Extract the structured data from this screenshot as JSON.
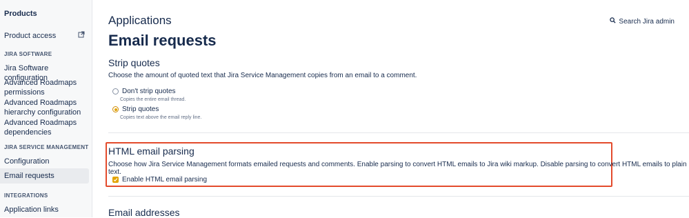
{
  "sidebar": {
    "title": "Products",
    "product_access": "Product access",
    "sections": [
      {
        "heading": "JIRA SOFTWARE"
      },
      {
        "heading": "JIRA SERVICE MANAGEMENT"
      },
      {
        "heading": "INTEGRATIONS"
      }
    ],
    "items": {
      "jira_software_config": "Jira Software configuration",
      "adv_roadmaps_permissions": "Advanced Roadmaps permissions",
      "adv_roadmaps_hierarchy": "Advanced Roadmaps hierarchy configuration",
      "adv_roadmaps_dependencies": "Advanced Roadmaps dependencies",
      "configuration": "Configuration",
      "email_requests": "Email requests",
      "application_links": "Application links"
    }
  },
  "header": {
    "breadcrumb": "Applications",
    "title": "Email requests",
    "search_label": "Search Jira admin"
  },
  "strip_quotes": {
    "title": "Strip quotes",
    "description": "Choose the amount of quoted text that Jira Service Management copies from an email to a comment.",
    "options": [
      {
        "label": "Don't strip quotes",
        "helper": "Copies the entire email thread.",
        "selected": false
      },
      {
        "label": "Strip quotes",
        "helper": "Copies text above the email reply line.",
        "selected": true
      }
    ]
  },
  "html_parsing": {
    "title": "HTML email parsing",
    "description": "Choose how Jira Service Management formats emailed requests and comments. Enable parsing to convert HTML emails to Jira wiki markup. Disable parsing to convert HTML emails to plain text.",
    "checkbox_label": "Enable HTML email parsing",
    "checked": true
  },
  "email_addresses": {
    "title": "Email addresses"
  },
  "colors": {
    "accent": "#e2a300",
    "highlight_border": "#e34a2b"
  }
}
